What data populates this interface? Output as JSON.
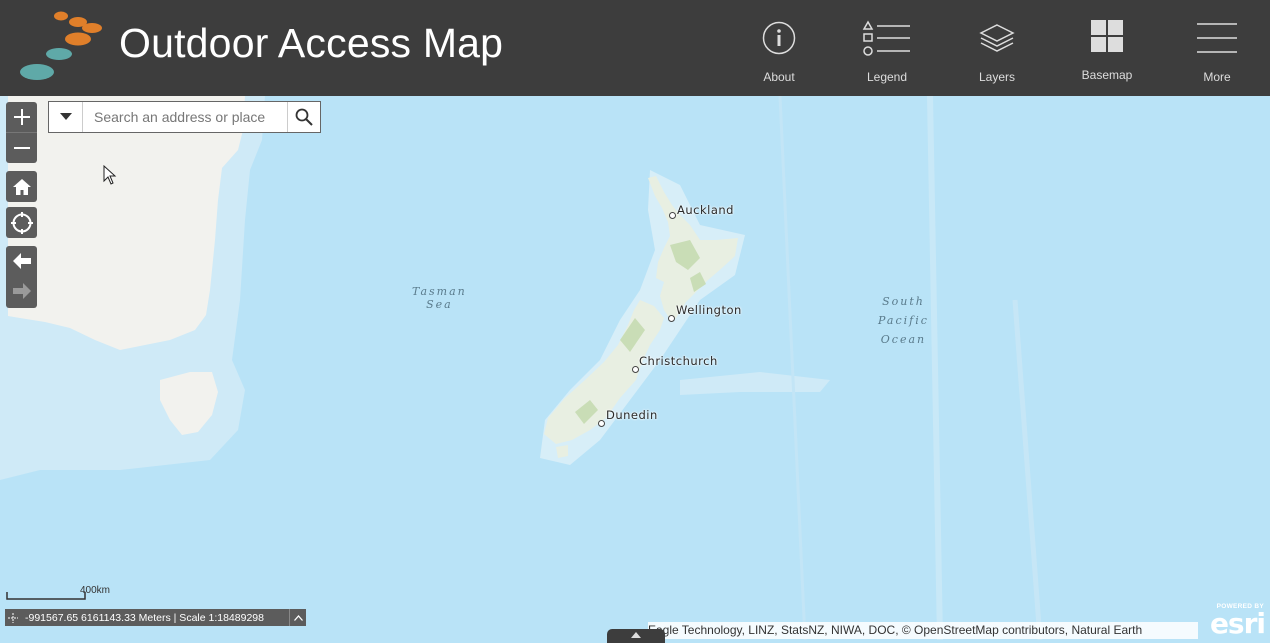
{
  "app": {
    "title": "Outdoor Access Map",
    "logo_colors": [
      "#e07f2a",
      "#e07f2a",
      "#e07f2a",
      "#5fa9a8",
      "#5fa9a8",
      "#5fa9a8"
    ]
  },
  "header": {
    "buttons": [
      {
        "label": "About",
        "icon": "info-icon"
      },
      {
        "label": "Legend",
        "icon": "legend-icon"
      },
      {
        "label": "Layers",
        "icon": "layers-icon"
      },
      {
        "label": "Basemap",
        "icon": "basemap-icon"
      },
      {
        "label": "More",
        "icon": "menu-icon"
      }
    ]
  },
  "search": {
    "placeholder": "Search an address or place",
    "value": ""
  },
  "map": {
    "labels": {
      "auckland": "Auckland",
      "wellington": "Wellington",
      "christchurch": "Christchurch",
      "dunedin": "Dunedin"
    },
    "oceans": {
      "tasman_line1": "Tasman",
      "tasman_line2": "Sea",
      "pacific_line1": "South",
      "pacific_line2": "Pacific",
      "pacific_line3": "Ocean"
    },
    "colors": {
      "ocean_deep": "#b9e3f7",
      "ocean_shelf": "#d7eef8",
      "land": "#f2f2ee",
      "nz_land": "#e8efe2",
      "nz_green": "#c9ddb6"
    }
  },
  "scale": {
    "label": "400km"
  },
  "coordinates": {
    "text": "-991567.65 6161143.33 Meters | Scale 1:18489298"
  },
  "attribution": {
    "text": "Eagle Technology, LINZ, StatsNZ, NIWA, DOC, © OpenStreetMap contributors, Natural Earth"
  },
  "esri": {
    "powered_by": "POWERED BY",
    "brand": "esri"
  }
}
